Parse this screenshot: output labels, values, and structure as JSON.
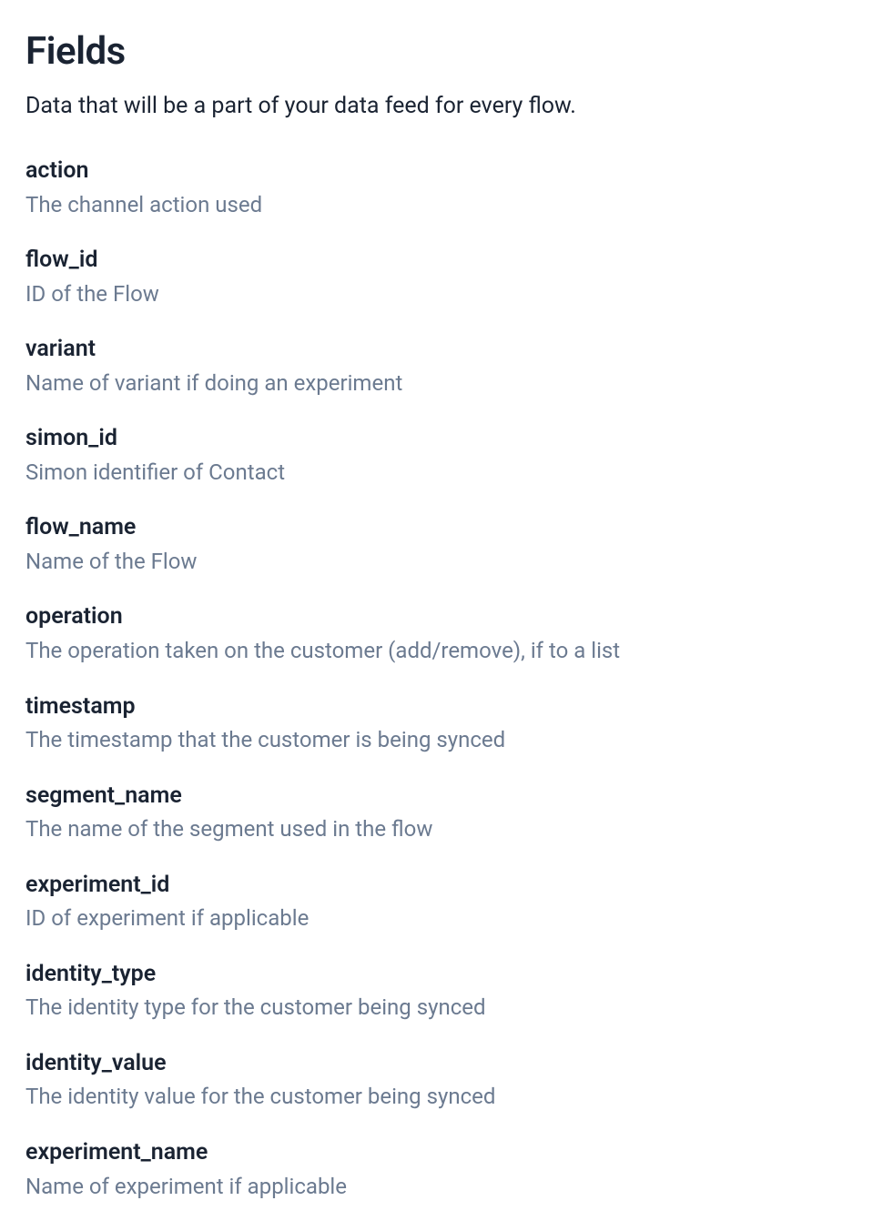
{
  "title": "Fields",
  "subtitle": "Data that will be a part of your data feed for every flow.",
  "fields": [
    {
      "name": "action",
      "description": "The channel action used"
    },
    {
      "name": "flow_id",
      "description": "ID of the Flow"
    },
    {
      "name": "variant",
      "description": "Name of variant if doing an experiment"
    },
    {
      "name": "simon_id",
      "description": "Simon identifier of Contact"
    },
    {
      "name": "flow_name",
      "description": "Name of the Flow"
    },
    {
      "name": "operation",
      "description": "The operation taken on the customer (add/remove), if to a list"
    },
    {
      "name": "timestamp",
      "description": "The timestamp that the customer is being synced"
    },
    {
      "name": "segment_name",
      "description": "The name of the segment used in the flow"
    },
    {
      "name": "experiment_id",
      "description": "ID of experiment if applicable"
    },
    {
      "name": "identity_type",
      "description": "The identity type for the customer being synced"
    },
    {
      "name": "identity_value",
      "description": "The identity value for the customer being synced"
    },
    {
      "name": "experiment_name",
      "description": "Name of experiment if applicable"
    }
  ]
}
